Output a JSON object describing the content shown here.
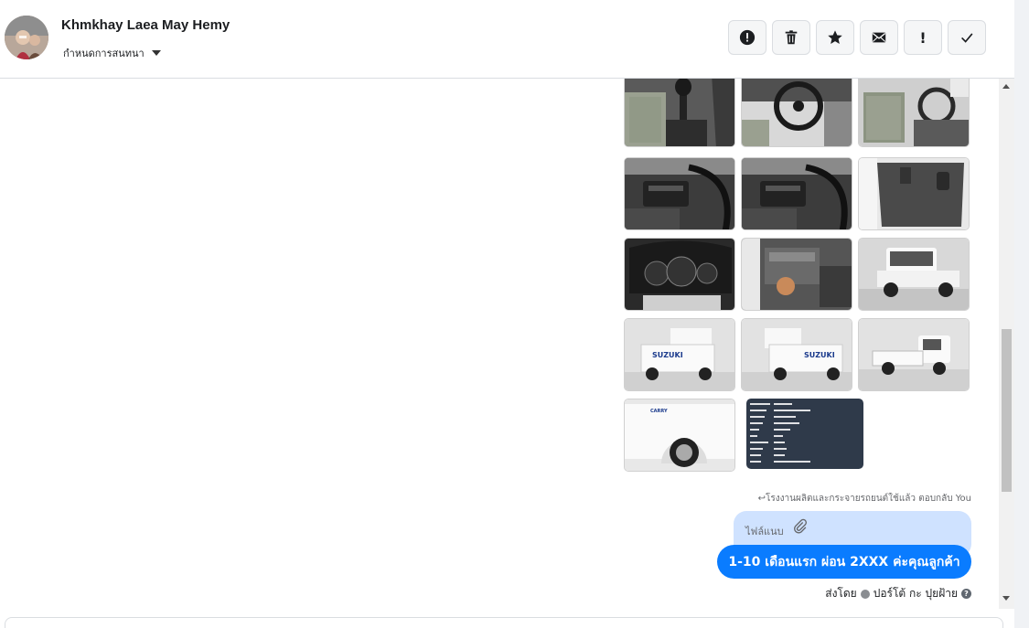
{
  "header": {
    "contact_name": "Khmkhay Laea May Hemy",
    "assign_label": "กำหนดการสนทนา",
    "toolbar_icons": [
      "alert-circle-icon",
      "trash-icon",
      "star-icon",
      "envelope-icon",
      "exclamation-icon",
      "checkmark-icon"
    ],
    "exclamation_text": "!"
  },
  "thread": {
    "photos": [
      "gear-shifter",
      "steering-wheel-dash",
      "seat-interior",
      "dashboard-left",
      "dashboard-center",
      "door-panel",
      "instrument-cluster",
      "engine-bay",
      "truck-front",
      "truck-rear-left",
      "truck-rear-right",
      "truck-side",
      "truck-front-wheel",
      "spec-sheet"
    ],
    "reply_note": "↩โรงงานผลิตและกระจายรถยนต์ใช้แล้ว ตอบกลับ You",
    "attachment_label": "ไฟล์แนบ",
    "message_text": "1-10 เดือนแรก ผ่อน 2XXX ค่ะคุณลูกค้า",
    "sent_by_prefix": "ส่งโดย",
    "sent_by_name": "ปอร์โต้ กะ ปุยฝ้าย",
    "help_glyph": "?"
  },
  "colors": {
    "bubble_blue": "#0a7cff",
    "attachment_bg": "#cfe2ff",
    "header_border": "#dadde1"
  }
}
